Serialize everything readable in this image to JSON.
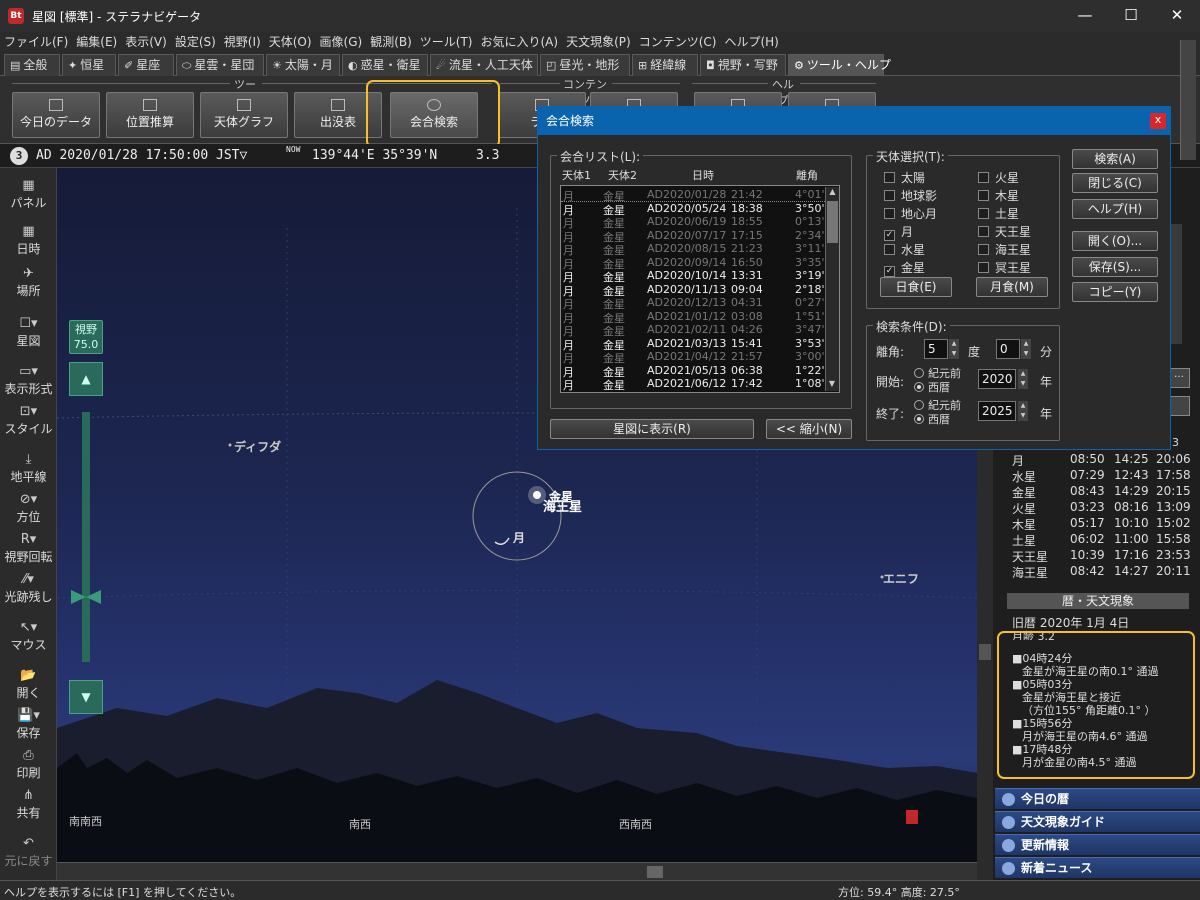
{
  "titlebar": {
    "app_icon": "Bt",
    "title": "星図 [標準] - ステラナビゲータ",
    "min": "—",
    "max": "☐",
    "close": "✕"
  },
  "menu": [
    "ファイル(F)",
    "編集(E)",
    "表示(V)",
    "設定(S)",
    "視野(I)",
    "天体(O)",
    "画像(G)",
    "観測(B)",
    "ツール(T)",
    "お気に入り(A)",
    "天文現象(P)",
    "コンテンツ(C)",
    "ヘルプ(H)"
  ],
  "tabs": [
    {
      "label": "全般",
      "icon": "▤"
    },
    {
      "label": "恒星",
      "icon": "✦"
    },
    {
      "label": "星座",
      "icon": "✐"
    },
    {
      "label": "星雲・星団",
      "icon": "⬭"
    },
    {
      "label": "太陽・月",
      "icon": "☀"
    },
    {
      "label": "惑星・衛星",
      "icon": "◐"
    },
    {
      "label": "流星・人工天体",
      "icon": "☄"
    },
    {
      "label": "昼光・地形",
      "icon": "◰"
    },
    {
      "label": "経緯線",
      "icon": "⊞"
    },
    {
      "label": "視野・写野",
      "icon": "◘"
    },
    {
      "label": "ツール・ヘルプ",
      "icon": "⚙"
    }
  ],
  "pin_icon": "⊤",
  "ribbon": {
    "group_tool": "ツール",
    "group_contents": "コンテンツ",
    "group_help": "ヘルプ",
    "buttons": [
      "今日のデータ",
      "位置推算",
      "天体グラフ",
      "出没表",
      "会合検索",
      "ライ",
      "",
      "",
      ""
    ]
  },
  "status": {
    "circle_num": "3",
    "datetime": "AD 2020/01/28 17:50:00 JST▽",
    "now_label": "NOW",
    "location": "139°44'E 35°39'N",
    "extra": "3.3"
  },
  "lefttools": [
    {
      "label": "パネル",
      "icon": "▦"
    },
    {
      "label": "日時",
      "icon": "▦"
    },
    {
      "label": "場所",
      "icon": "✈"
    },
    {
      "label": "星図",
      "icon": "☐▾"
    },
    {
      "label": "表示形式",
      "icon": "▭▾"
    },
    {
      "label": "スタイル",
      "icon": "⊡▾"
    },
    {
      "label": "地平線",
      "icon": "⤓"
    },
    {
      "label": "方位",
      "icon": "⊘▾"
    },
    {
      "label": "視野回転",
      "icon": "R▾"
    },
    {
      "label": "光跡残し",
      "icon": "⁄⁄▾"
    },
    {
      "label": "マウス",
      "icon": "↖▾"
    },
    {
      "label": "開く",
      "icon": "📂"
    },
    {
      "label": "保存",
      "icon": "💾▾"
    },
    {
      "label": "印刷",
      "icon": "⎙"
    },
    {
      "label": "共有",
      "icon": "⋔"
    },
    {
      "label": "元に戻す",
      "icon": "↶"
    }
  ],
  "sky": {
    "fov_label": "視野",
    "fov_value": "75.0",
    "labels": {
      "deneb": "ディフダ",
      "venus": "金星",
      "neptune": "海王星",
      "moon": "月",
      "enif": "エニフ"
    },
    "directions": [
      "南南西",
      "南西",
      "西南西"
    ],
    "up_arrow": "▲",
    "down_arrow": "▼"
  },
  "dialog": {
    "title": "会合検索",
    "close": "x",
    "list_label": "会合リスト(L):",
    "headers": [
      "天体1",
      "天体2",
      "日時",
      "離角"
    ],
    "rows": [
      {
        "b1": "月",
        "b2": "金星",
        "date": "AD2020/01/28",
        "time": "21:42",
        "sep": "4°01'",
        "dim": true
      },
      {
        "b1": "月",
        "b2": "金星",
        "date": "AD2020/05/24",
        "time": "18:38",
        "sep": "3°50'",
        "dim": false
      },
      {
        "b1": "月",
        "b2": "金星",
        "date": "AD2020/06/19",
        "time": "18:55",
        "sep": "0°13'",
        "dim": true
      },
      {
        "b1": "月",
        "b2": "金星",
        "date": "AD2020/07/17",
        "time": "17:15",
        "sep": "2°34'",
        "dim": true
      },
      {
        "b1": "月",
        "b2": "金星",
        "date": "AD2020/08/15",
        "time": "21:23",
        "sep": "3°11'",
        "dim": true
      },
      {
        "b1": "月",
        "b2": "金星",
        "date": "AD2020/09/14",
        "time": "16:50",
        "sep": "3°35'",
        "dim": true
      },
      {
        "b1": "月",
        "b2": "金星",
        "date": "AD2020/10/14",
        "time": "13:31",
        "sep": "3°19'",
        "dim": false
      },
      {
        "b1": "月",
        "b2": "金星",
        "date": "AD2020/11/13",
        "time": "09:04",
        "sep": "2°18'",
        "dim": false
      },
      {
        "b1": "月",
        "b2": "金星",
        "date": "AD2020/12/13",
        "time": "04:31",
        "sep": "0°27'",
        "dim": true
      },
      {
        "b1": "月",
        "b2": "金星",
        "date": "AD2021/01/12",
        "time": "03:08",
        "sep": "1°51'",
        "dim": true
      },
      {
        "b1": "月",
        "b2": "金星",
        "date": "AD2021/02/11",
        "time": "04:26",
        "sep": "3°47'",
        "dim": true
      },
      {
        "b1": "月",
        "b2": "金星",
        "date": "AD2021/03/13",
        "time": "15:41",
        "sep": "3°53'",
        "dim": false
      },
      {
        "b1": "月",
        "b2": "金星",
        "date": "AD2021/04/12",
        "time": "21:57",
        "sep": "3°00'",
        "dim": true
      },
      {
        "b1": "月",
        "b2": "金星",
        "date": "AD2021/05/13",
        "time": "06:38",
        "sep": "1°22'",
        "dim": false
      },
      {
        "b1": "月",
        "b2": "金星",
        "date": "AD2021/06/12",
        "time": "17:42",
        "sep": "1°08'",
        "dim": false
      }
    ],
    "show_button": "星図に表示(R)",
    "shrink_button": "<< 縮小(N)",
    "body_select_label": "天体選択(T):",
    "bodies_left": [
      {
        "label": "太陽",
        "checked": false
      },
      {
        "label": "地球影",
        "checked": false
      },
      {
        "label": "地心月",
        "checked": false
      },
      {
        "label": "月",
        "checked": true
      },
      {
        "label": "水星",
        "checked": false
      },
      {
        "label": "金星",
        "checked": true
      }
    ],
    "bodies_right": [
      {
        "label": "火星",
        "checked": false
      },
      {
        "label": "木星",
        "checked": false
      },
      {
        "label": "土星",
        "checked": false
      },
      {
        "label": "天王星",
        "checked": false
      },
      {
        "label": "海王星",
        "checked": false
      },
      {
        "label": "冥王星",
        "checked": false
      }
    ],
    "solar_eclipse": "日食(E)",
    "lunar_eclipse": "月食(M)",
    "condition_label": "検索条件(D):",
    "sep_label": "離角:",
    "sep_deg": "5",
    "deg_unit": "度",
    "sep_min": "0",
    "min_unit": "分",
    "start_label": "開始:",
    "end_label": "終了:",
    "bc_label": "紀元前",
    "ad_label": "西暦",
    "start_year": "2020",
    "end_year": "2025",
    "year_unit": "年",
    "buttons": [
      "検索(A)",
      "閉じる(C)",
      "ヘルプ(H)",
      "開く(O)...",
      "保存(S)...",
      "コピー(Y)"
    ]
  },
  "rightpanel": {
    "partial_top": "3",
    "planets": [
      {
        "name": "月",
        "rise": "08:50",
        "transit": "14:25",
        "set": "20:06"
      },
      {
        "name": "水星",
        "rise": "07:29",
        "transit": "12:43",
        "set": "17:58"
      },
      {
        "name": "金星",
        "rise": "08:43",
        "transit": "14:29",
        "set": "20:15"
      },
      {
        "name": "火星",
        "rise": "03:23",
        "transit": "08:16",
        "set": "13:09"
      },
      {
        "name": "木星",
        "rise": "05:17",
        "transit": "10:10",
        "set": "15:02"
      },
      {
        "name": "土星",
        "rise": "06:02",
        "transit": "11:00",
        "set": "15:58"
      },
      {
        "name": "天王星",
        "rise": "10:39",
        "transit": "17:16",
        "set": "23:53"
      },
      {
        "name": "海王星",
        "rise": "08:42",
        "transit": "14:27",
        "set": "20:11"
      }
    ],
    "calendar_header": "暦・天文現象",
    "lunar_calendar": "旧暦 2020年 1月 4日",
    "moon_age": "月齢 3.2",
    "events": [
      {
        "time": "■04時24分",
        "lines": [
          "金星が海王星の南0.1° 通過"
        ]
      },
      {
        "time": "■05時03分",
        "lines": [
          "金星が海王星と接近",
          "（方位155° 角距離0.1° ）"
        ]
      },
      {
        "time": "■15時56分",
        "lines": [
          "月が海王星の南4.6° 通過"
        ]
      },
      {
        "time": "■17時48分",
        "lines": [
          "月が金星の南4.5° 通過"
        ]
      }
    ],
    "nav": [
      "今日の暦",
      "天文現象ガイド",
      "更新情報",
      "新着ニュース"
    ]
  },
  "statusbar": {
    "help": "ヘルプを表示するには [F1] を押してください。",
    "azimuth": "方位:  59.4°  高度:  27.5°"
  }
}
